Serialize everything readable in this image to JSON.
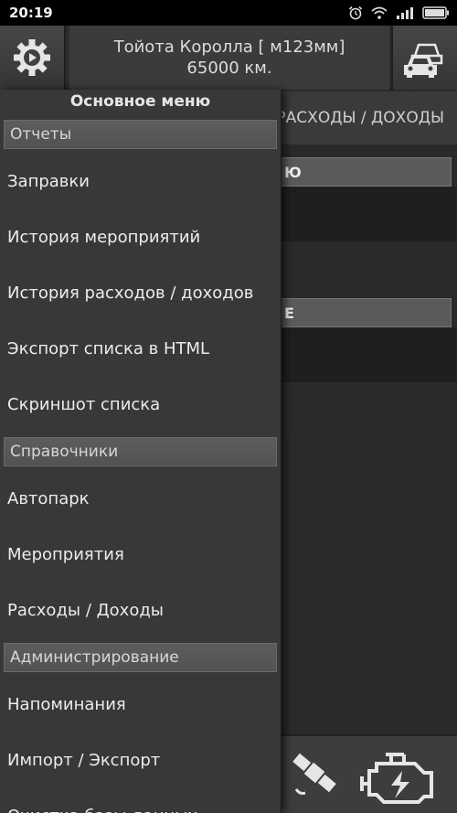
{
  "status_bar": {
    "time": "20:19",
    "icons": [
      "alarm-icon",
      "wifi-icon",
      "signal-icon",
      "battery-icon"
    ]
  },
  "header": {
    "car_name": "Тойота Королла [ м123мм]",
    "odometer": "65000 км."
  },
  "background_page": {
    "tab_label": "РАСХОДЫ / ДОХОДЫ",
    "section1_label": "Ю",
    "section2_label": "Е"
  },
  "drawer": {
    "title": "Основное меню",
    "sections": [
      {
        "header": "Отчеты",
        "items": [
          "Заправки",
          "История мероприятий",
          "История расходов / доходов",
          "Экспорт списка в HTML",
          "Скриншот списка"
        ]
      },
      {
        "header": "Справочники",
        "items": [
          "Автопарк",
          "Мероприятия",
          "Расходы / Доходы"
        ]
      },
      {
        "header": "Администрирование",
        "items": [
          "Напоминания",
          "Импорт / Экспорт",
          "Очистка базы данных"
        ]
      }
    ]
  },
  "colors": {
    "drawer_bg": "#383838",
    "section_header_bg": "#5a5a5a",
    "text": "#ececec"
  }
}
